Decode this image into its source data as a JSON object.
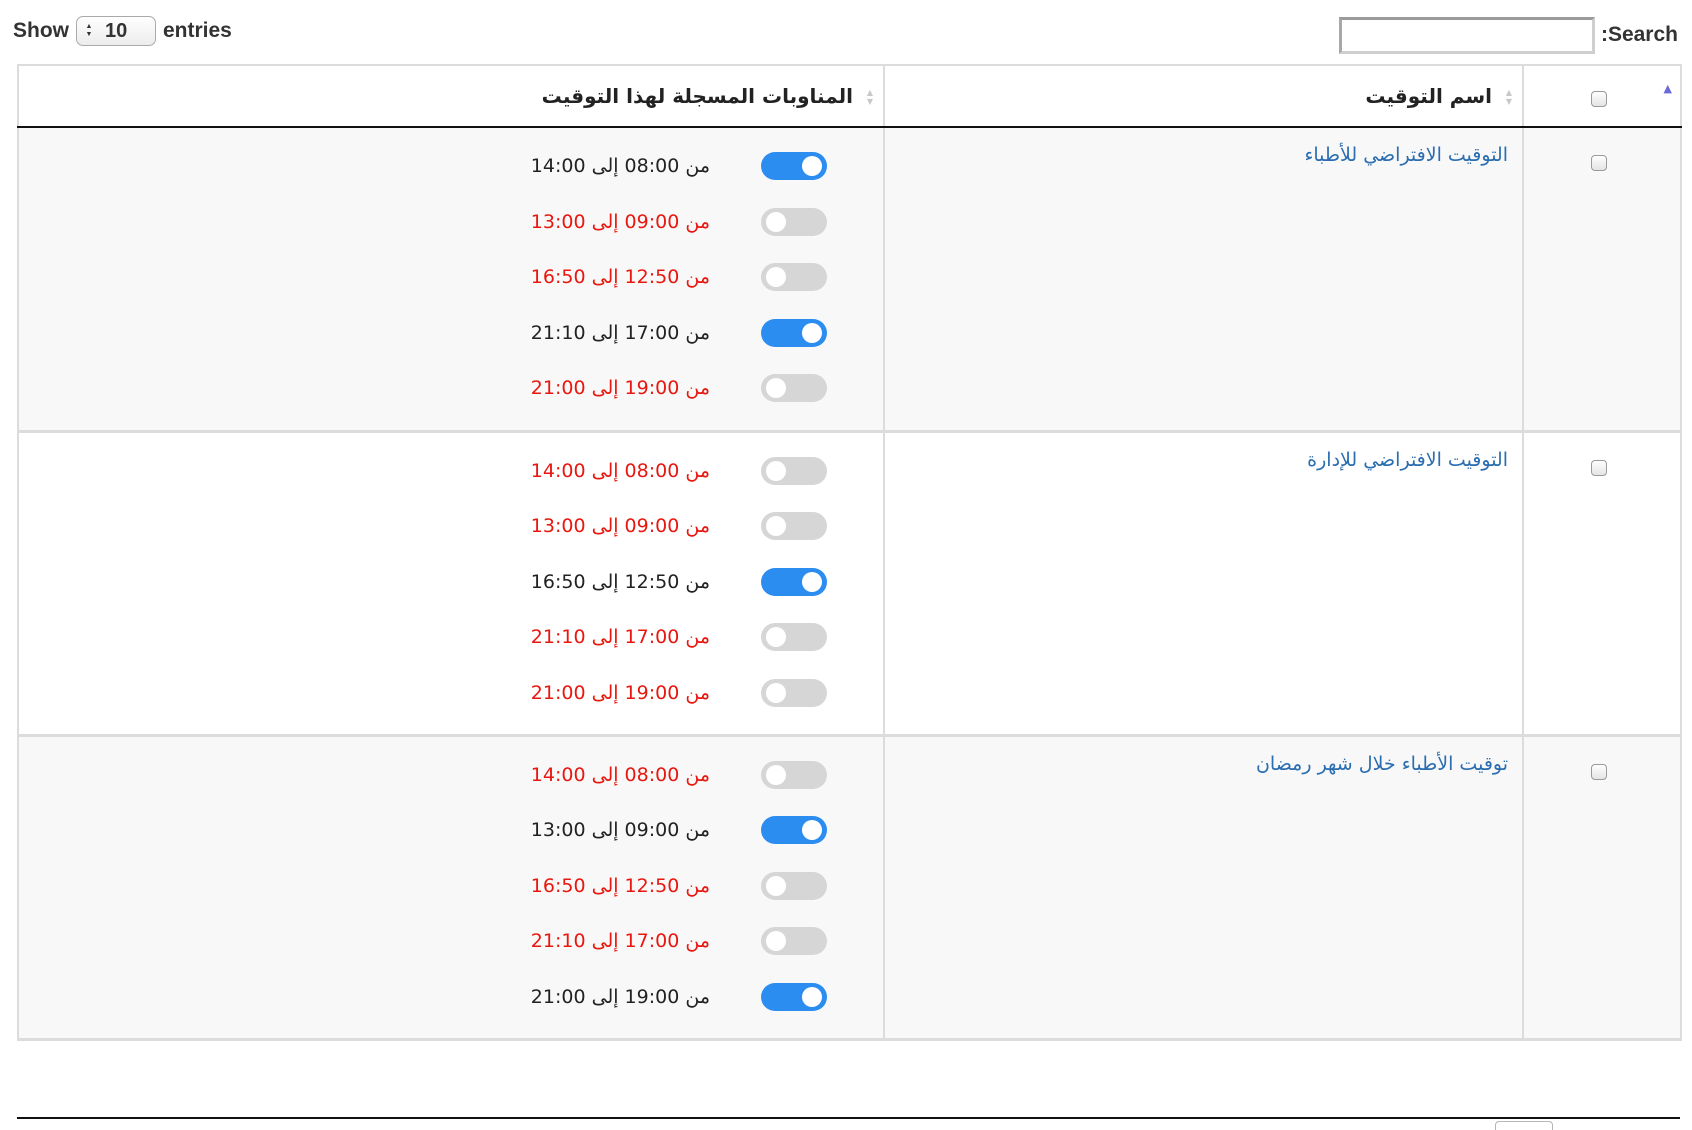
{
  "length_control": {
    "show_label": "Show",
    "value": "10",
    "entries_label": "entries"
  },
  "search": {
    "label": ":Search",
    "value": ""
  },
  "table": {
    "headers": {
      "select_all": "",
      "name": "اسم التوقيت",
      "shifts": "المناوبات المسجلة لهذا التوقيت"
    },
    "rows": [
      {
        "name": "التوقيت الافتراضي للأطباء",
        "shifts": [
          {
            "text": "من 08:00 إلى 14:00",
            "enabled": true
          },
          {
            "text": "من 09:00 إلى 13:00",
            "enabled": false
          },
          {
            "text": "من 12:50 إلى 16:50",
            "enabled": false
          },
          {
            "text": "من 17:00 إلى 21:10",
            "enabled": true
          },
          {
            "text": "من 19:00 إلى 21:00",
            "enabled": false
          }
        ]
      },
      {
        "name": "التوقيت الافتراضي للإدارة",
        "shifts": [
          {
            "text": "من 08:00 إلى 14:00",
            "enabled": false
          },
          {
            "text": "من 09:00 إلى 13:00",
            "enabled": false
          },
          {
            "text": "من 12:50 إلى 16:50",
            "enabled": true
          },
          {
            "text": "من 17:00 إلى 21:10",
            "enabled": false
          },
          {
            "text": "من 19:00 إلى 21:00",
            "enabled": false
          }
        ]
      },
      {
        "name": "توقيت الأطباء خلال شهر رمضان",
        "shifts": [
          {
            "text": "من 08:00 إلى 14:00",
            "enabled": false
          },
          {
            "text": "من 09:00 إلى 13:00",
            "enabled": true
          },
          {
            "text": "من 12:50 إلى 16:50",
            "enabled": false
          },
          {
            "text": "من 17:00 إلى 21:10",
            "enabled": false
          },
          {
            "text": "من 19:00 إلى 21:00",
            "enabled": true
          }
        ]
      }
    ]
  },
  "colors": {
    "toggle_on": "#2b8df0",
    "toggle_off": "#d6d6d6",
    "inactive_text": "#e8170f",
    "link": "#2a6db0"
  }
}
